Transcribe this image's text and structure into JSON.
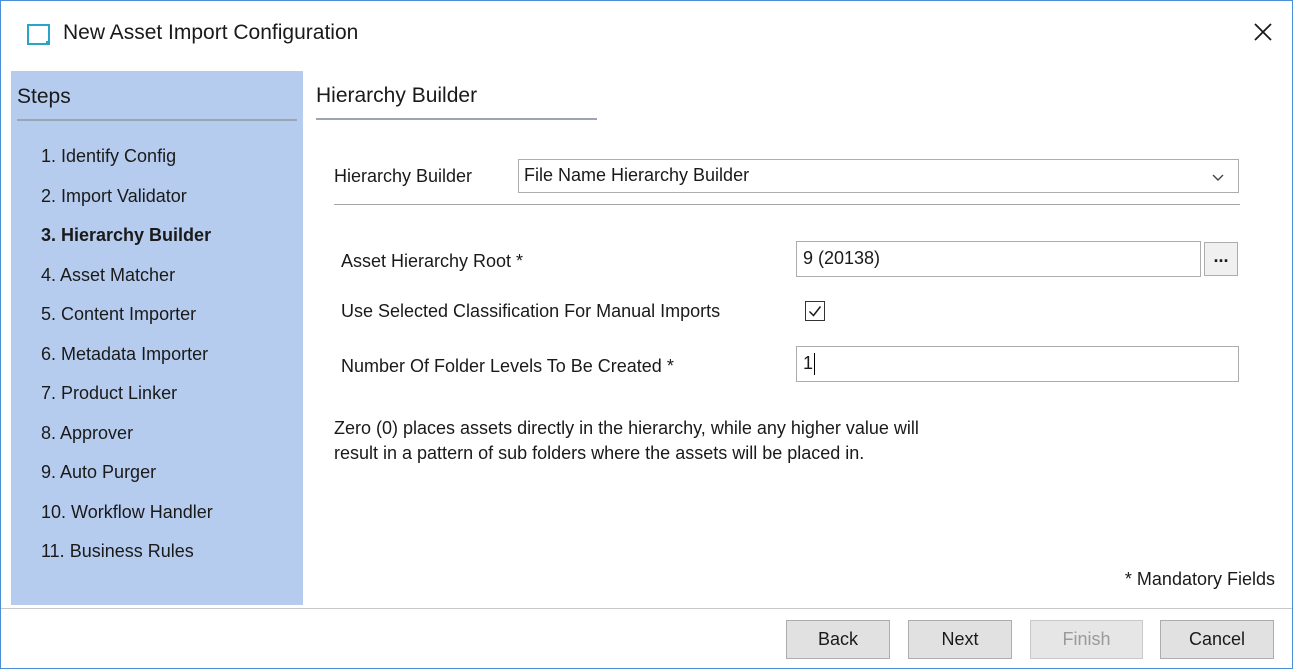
{
  "window": {
    "title": "New Asset Import Configuration"
  },
  "sidebar": {
    "title": "Steps",
    "steps": [
      {
        "label": "1. Identify Config",
        "active": false
      },
      {
        "label": "2. Import Validator",
        "active": false
      },
      {
        "label": "3. Hierarchy Builder",
        "active": true
      },
      {
        "label": "4. Asset Matcher",
        "active": false
      },
      {
        "label": "5. Content Importer",
        "active": false
      },
      {
        "label": "6. Metadata Importer",
        "active": false
      },
      {
        "label": "7. Product Linker",
        "active": false
      },
      {
        "label": "8. Approver",
        "active": false
      },
      {
        "label": "9. Auto Purger",
        "active": false
      },
      {
        "label": "10. Workflow Handler",
        "active": false
      },
      {
        "label": "11. Business Rules",
        "active": false
      }
    ]
  },
  "main": {
    "section_title": "Hierarchy Builder",
    "builder_label": "Hierarchy Builder",
    "builder_value": "File Name Hierarchy Builder",
    "root_label": "Asset Hierarchy Root *",
    "root_value": "9 (20138)",
    "browse_label": "...",
    "classification_label": "Use Selected Classification For Manual Imports",
    "classification_checked": true,
    "levels_label": "Number Of Folder Levels To Be Created *",
    "levels_value": "1",
    "help_line1": "Zero (0) places assets directly in the hierarchy, while any higher value will",
    "help_line2": "result in a pattern of sub folders where the assets will be placed in.",
    "mandatory_note": "* Mandatory Fields"
  },
  "buttons": {
    "back": "Back",
    "next": "Next",
    "finish": "Finish",
    "cancel": "Cancel"
  }
}
